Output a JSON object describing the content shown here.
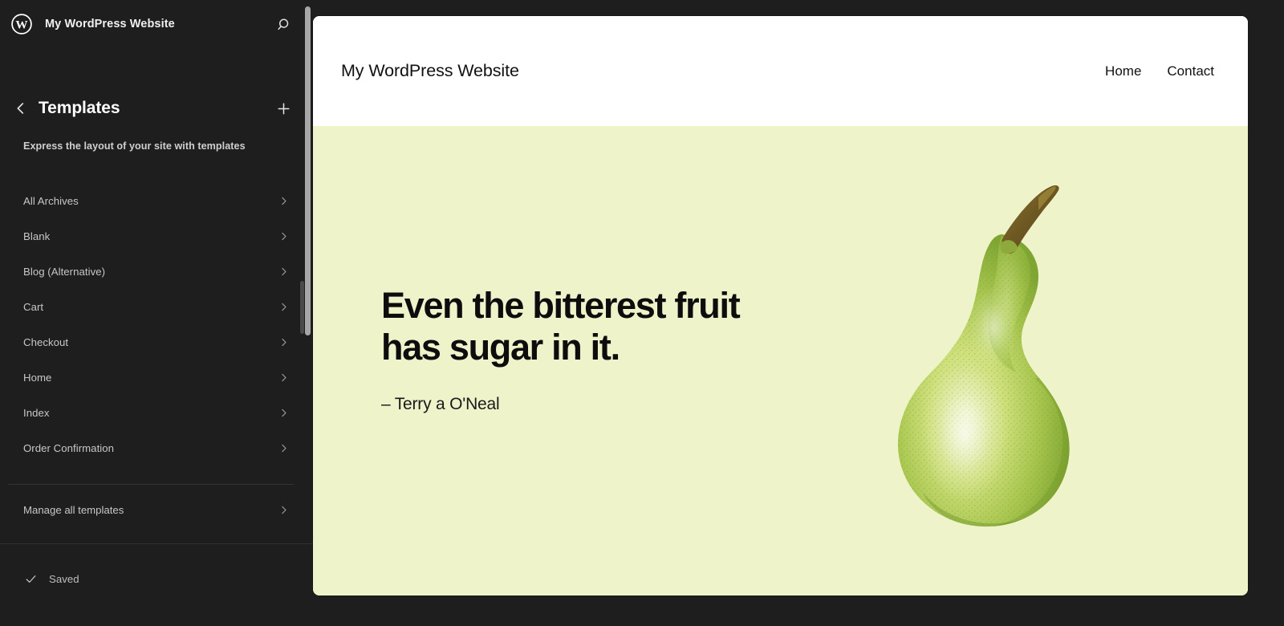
{
  "sidebar": {
    "hub": {
      "logo_icon": "wordpress-logo-icon",
      "site_title": "My WordPress Website",
      "search_icon": "search-icon"
    },
    "panel": {
      "back_icon": "chevron-left-icon",
      "title": "Templates",
      "add_icon": "plus-icon",
      "description": "Express the layout of your site with templates"
    },
    "templates": [
      {
        "label": "All Archives",
        "chevron": "chevron-right-icon"
      },
      {
        "label": "Blank",
        "chevron": "chevron-right-icon"
      },
      {
        "label": "Blog (Alternative)",
        "chevron": "chevron-right-icon"
      },
      {
        "label": "Cart",
        "chevron": "chevron-right-icon"
      },
      {
        "label": "Checkout",
        "chevron": "chevron-right-icon"
      },
      {
        "label": "Home",
        "chevron": "chevron-right-icon"
      },
      {
        "label": "Index",
        "chevron": "chevron-right-icon"
      },
      {
        "label": "Order Confirmation",
        "chevron": "chevron-right-icon"
      }
    ],
    "manage": {
      "label": "Manage all templates",
      "chevron": "chevron-right-icon"
    },
    "footer": {
      "check_icon": "checkmark-icon",
      "status": "Saved"
    }
  },
  "canvas": {
    "site_header": {
      "brand": "My WordPress Website",
      "nav": [
        {
          "label": "Home"
        },
        {
          "label": "Contact"
        }
      ]
    },
    "content": {
      "quote": "Even the bitterest fruit has sugar in it.",
      "citation": "– Terry a O'Neal",
      "image_name": "pear-illustration"
    }
  },
  "colors": {
    "sidebar_bg": "#1e1e1e",
    "canvas_header_bg": "#ffffff",
    "canvas_body_bg": "#eff3ca",
    "text_primary": "#ffffff",
    "text_muted": "#c7c7c7",
    "pear_green": "#9cc04a",
    "pear_stem": "#7a6328"
  }
}
